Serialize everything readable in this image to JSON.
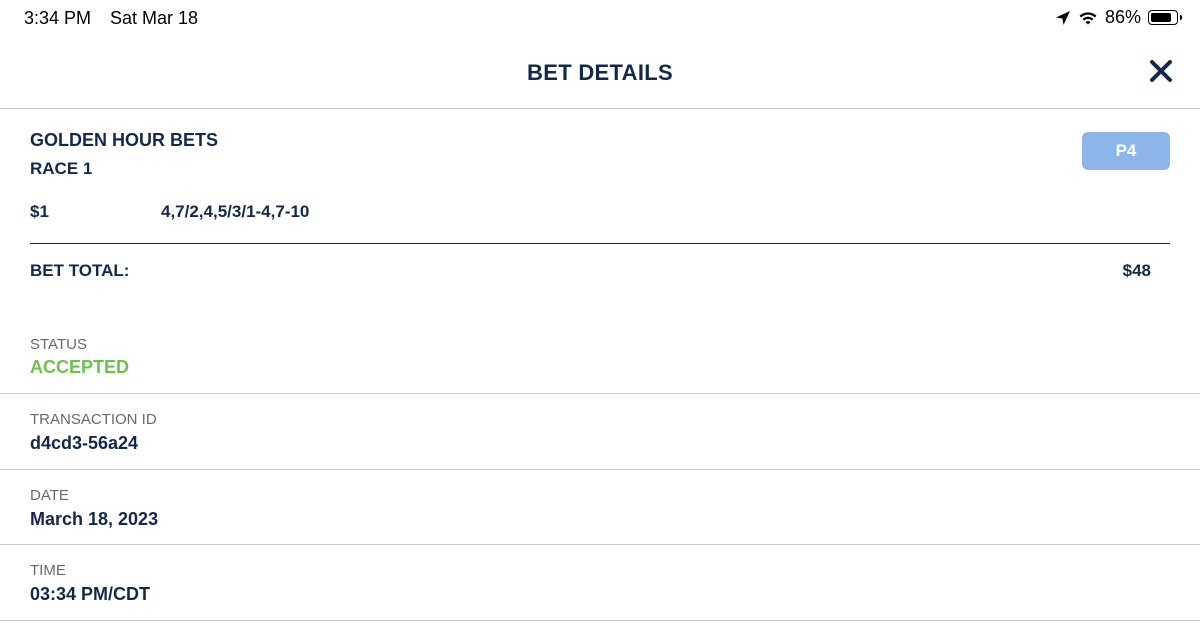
{
  "status_bar": {
    "time": "3:34 PM",
    "date": "Sat Mar 18",
    "battery_percent": "86%",
    "battery_level": 0.86,
    "icons": [
      "location-arrow-icon",
      "wifi-icon",
      "battery-icon"
    ]
  },
  "header": {
    "title": "BET DETAILS",
    "close_icon": "close-icon"
  },
  "bet": {
    "track": "GOLDEN HOUR BETS",
    "race": "RACE 1",
    "bet_type": "P4",
    "amount": "$1",
    "selections": "4,7/2,4,5/3/1-4,7-10",
    "total_label": "BET TOTAL:",
    "total_value": "$48"
  },
  "details": {
    "status_label": "STATUS",
    "status_value": "ACCEPTED",
    "transaction_label": "TRANSACTION ID",
    "transaction_value": "d4cd3-56a24",
    "date_label": "DATE",
    "date_value": "March 18, 2023",
    "time_label": "TIME",
    "time_value": "03:34 PM/CDT"
  },
  "colors": {
    "text_primary": "#13294b",
    "accepted_green": "#6cc24a",
    "badge_blue": "#8cb6ea",
    "label_gray": "#666a70",
    "divider_gray": "#c9c9c9"
  }
}
